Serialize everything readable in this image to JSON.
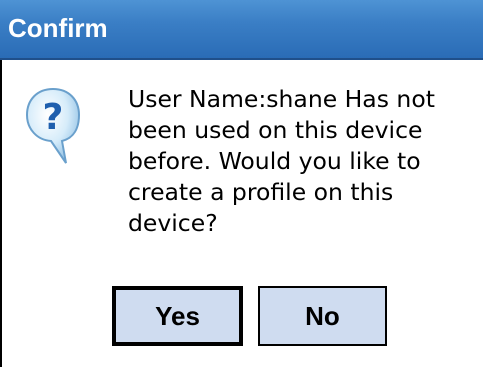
{
  "dialog": {
    "title": "Confirm",
    "icon": "question-icon",
    "message": "User Name:shane Has not\nbeen used on this device\nbefore. Would you like to\ncreate a profile on this\ndevice?",
    "buttons": {
      "yes_label": "Yes",
      "no_label": "No"
    }
  },
  "colors": {
    "titlebar": "#3a7ec5",
    "title_text": "#ffffff",
    "button_fill": "#cfdcf0",
    "icon_bubble": "#cfe6f7",
    "icon_glyph": "#1f5fae"
  }
}
